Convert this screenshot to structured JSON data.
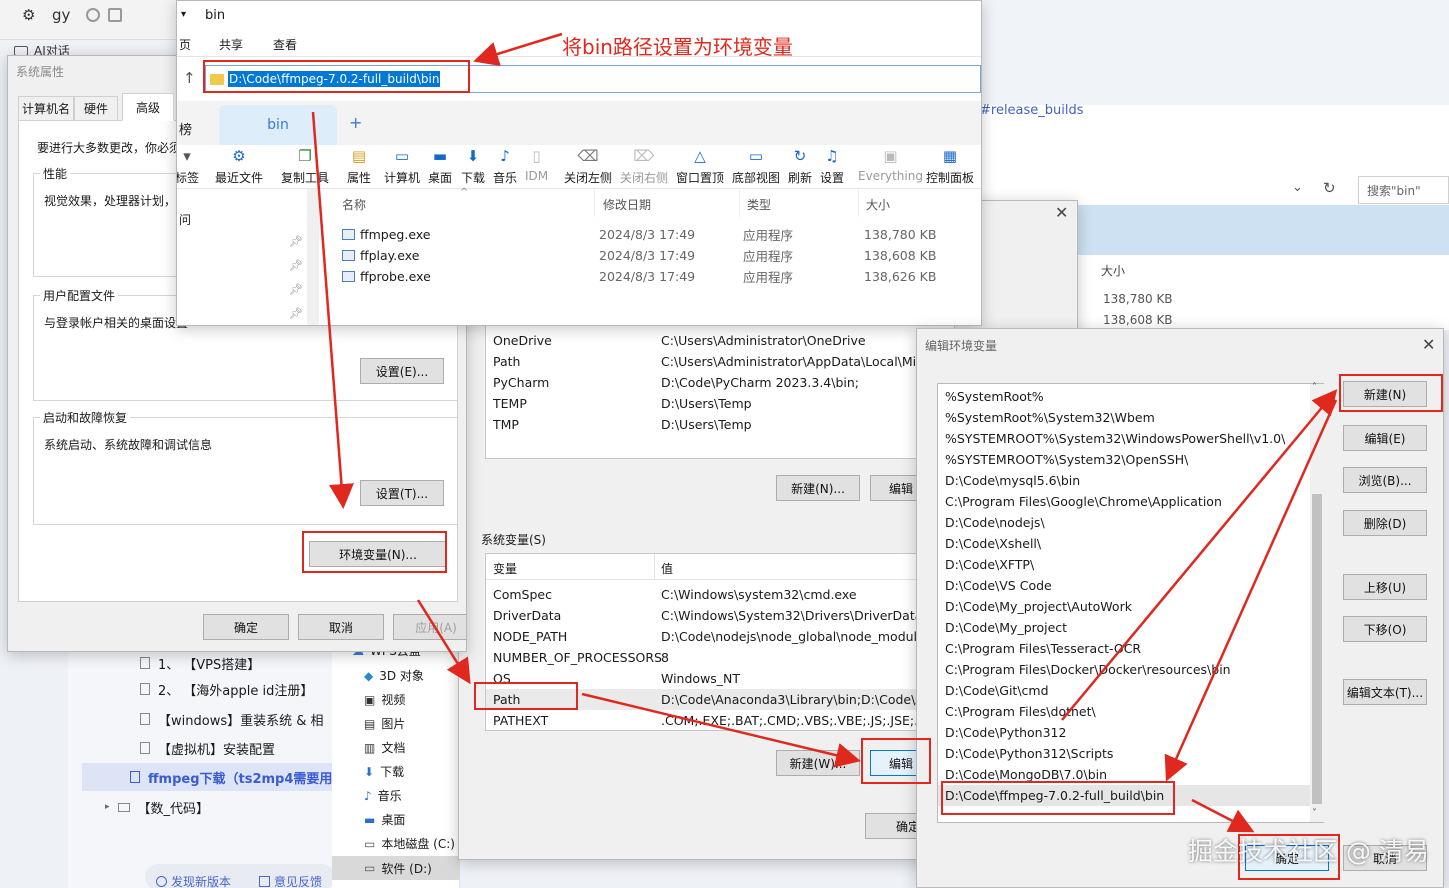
{
  "browser": {
    "tab_title": "gy",
    "folder_label": "AI对话",
    "url_fragment": "#release_builds",
    "search_placeholder": "搜索\"bin\""
  },
  "sidebar": {
    "items": [
      {
        "num": "1、",
        "label": "【VPS搭建】"
      },
      {
        "num": "2、",
        "label": "【海外apple id注册】"
      },
      {
        "num": "",
        "label": "【windows】重装系统 & 相"
      },
      {
        "num": "",
        "label": "【虚拟机】安装配置"
      },
      {
        "num": "",
        "label": "ffmpeg下载（ts2mp4需要用"
      },
      {
        "num": "",
        "label": "【数_代码】"
      }
    ],
    "footer": {
      "new_version": "发现新版本",
      "feedback": "意见反馈"
    }
  },
  "explorer_nav": {
    "items": [
      "WPS云盘",
      "3D 对象",
      "视频",
      "图片",
      "文档",
      "下载",
      "音乐",
      "桌面",
      "本地磁盘 (C:)",
      "软件 (D:)"
    ]
  },
  "bg_list": {
    "header": "大小",
    "sizes": [
      "138,780 KB",
      "138,608 KB"
    ]
  },
  "sysprops": {
    "title": "系统属性",
    "tabs": [
      "计算机名",
      "硬件",
      "高级"
    ],
    "note": "要进行大多数更改，你必须",
    "perf_label": "性能",
    "perf_desc": "视觉效果，处理器计划，",
    "profile_label": "用户配置文件",
    "profile_desc": "与登录帐户相关的桌面设置",
    "profile_btn": "设置(E)...",
    "startup_label": "启动和故障恢复",
    "startup_desc": "系统启动、系统故障和调试信息",
    "startup_btn": "设置(T)...",
    "env_btn": "环境变量(N)...",
    "ok": "确定",
    "cancel": "取消",
    "apply": "应用(A)"
  },
  "explorer": {
    "title": "bin",
    "menu": [
      "页",
      "共享",
      "查看"
    ],
    "path": "D:\\Code\\ffmpeg-7.0.2-full_build\\bin",
    "tab_label": "bin",
    "left_partial": "榜",
    "toolbar": [
      "标签",
      "最近文件",
      "复制工具",
      "属性",
      "计算机",
      "桌面",
      "下载",
      "音乐",
      "IDM",
      "关闭左侧",
      "关闭右侧",
      "窗口置顶",
      "底部视图",
      "刷新",
      "设置",
      "Everything",
      "控制面板"
    ],
    "headers": {
      "name": "名称",
      "date": "修改日期",
      "type": "类型",
      "size": "大小"
    },
    "left_item": "问",
    "files": [
      {
        "name": "ffmpeg.exe",
        "date": "2024/8/3 17:49",
        "type": "应用程序",
        "size": "138,780 KB"
      },
      {
        "name": "ffplay.exe",
        "date": "2024/8/3 17:49",
        "type": "应用程序",
        "size": "138,608 KB"
      },
      {
        "name": "ffprobe.exe",
        "date": "2024/8/3 17:49",
        "type": "应用程序",
        "size": "138,626 KB"
      }
    ]
  },
  "envvars": {
    "user_vars": [
      {
        "name": "OneDrive",
        "value": "C:\\Users\\Administrator\\OneDrive"
      },
      {
        "name": "Path",
        "value": "C:\\Users\\Administrator\\AppData\\Local\\Micro"
      },
      {
        "name": "PyCharm",
        "value": "D:\\Code\\PyCharm 2023.3.4\\bin;"
      },
      {
        "name": "TEMP",
        "value": "D:\\Users\\Temp"
      },
      {
        "name": "TMP",
        "value": "D:\\Users\\Temp"
      }
    ],
    "user_new": "新建(N)...",
    "user_edit": "编辑",
    "sys_label": "系统变量(S)",
    "col_var": "变量",
    "col_val": "值",
    "sys_vars": [
      {
        "name": "ComSpec",
        "value": "C:\\Windows\\system32\\cmd.exe"
      },
      {
        "name": "DriverData",
        "value": "C:\\Windows\\System32\\Drivers\\DriverData"
      },
      {
        "name": "NODE_PATH",
        "value": "D:\\Code\\nodejs\\node_global\\node_modules"
      },
      {
        "name": "NUMBER_OF_PROCESSORS",
        "value": "8"
      },
      {
        "name": "OS",
        "value": "Windows_NT"
      },
      {
        "name": "Path",
        "value": "D:\\Code\\Anaconda3\\Library\\bin;D:\\Code\\An"
      },
      {
        "name": "PATHEXT",
        "value": ".COM;.EXE;.BAT;.CMD;.VBS;.VBE;.JS;.JSE;.WSF"
      }
    ],
    "sys_new": "新建(W)...",
    "sys_edit": "编辑",
    "ok": "确定"
  },
  "editenv": {
    "title": "编辑环境变量",
    "entries": [
      "%SystemRoot%",
      "%SystemRoot%\\System32\\Wbem",
      "%SYSTEMROOT%\\System32\\WindowsPowerShell\\v1.0\\",
      "%SYSTEMROOT%\\System32\\OpenSSH\\",
      "D:\\Code\\mysql5.6\\bin",
      "C:\\Program Files\\Google\\Chrome\\Application",
      "D:\\Code\\nodejs\\",
      "D:\\Code\\Xshell\\",
      "D:\\Code\\XFTP\\",
      "D:\\Code\\VS Code",
      "D:\\Code\\My_project\\AutoWork",
      "D:\\Code\\My_project",
      "C:\\Program Files\\Tesseract-OCR",
      "C:\\Program Files\\Docker\\Docker\\resources\\bin",
      "D:\\Code\\Git\\cmd",
      "C:\\Program Files\\dotnet\\",
      "D:\\Code\\Python312",
      "D:\\Code\\Python312\\Scripts",
      "D:\\Code\\MongoDB\\7.0\\bin",
      "D:\\Code\\ffmpeg-7.0.2-full_build\\bin"
    ],
    "btn_new": "新建(N)",
    "btn_edit": "编辑(E)",
    "btn_browse": "浏览(B)...",
    "btn_delete": "删除(D)",
    "btn_up": "上移(U)",
    "btn_down": "下移(O)",
    "btn_edit_text": "编辑文本(T)...",
    "ok": "确定",
    "cancel": "取消"
  },
  "annotation": {
    "text": "将bin路径设置为环境变量",
    "color": "#e0281e"
  },
  "watermark": "掘金技术社区 @ 清易"
}
